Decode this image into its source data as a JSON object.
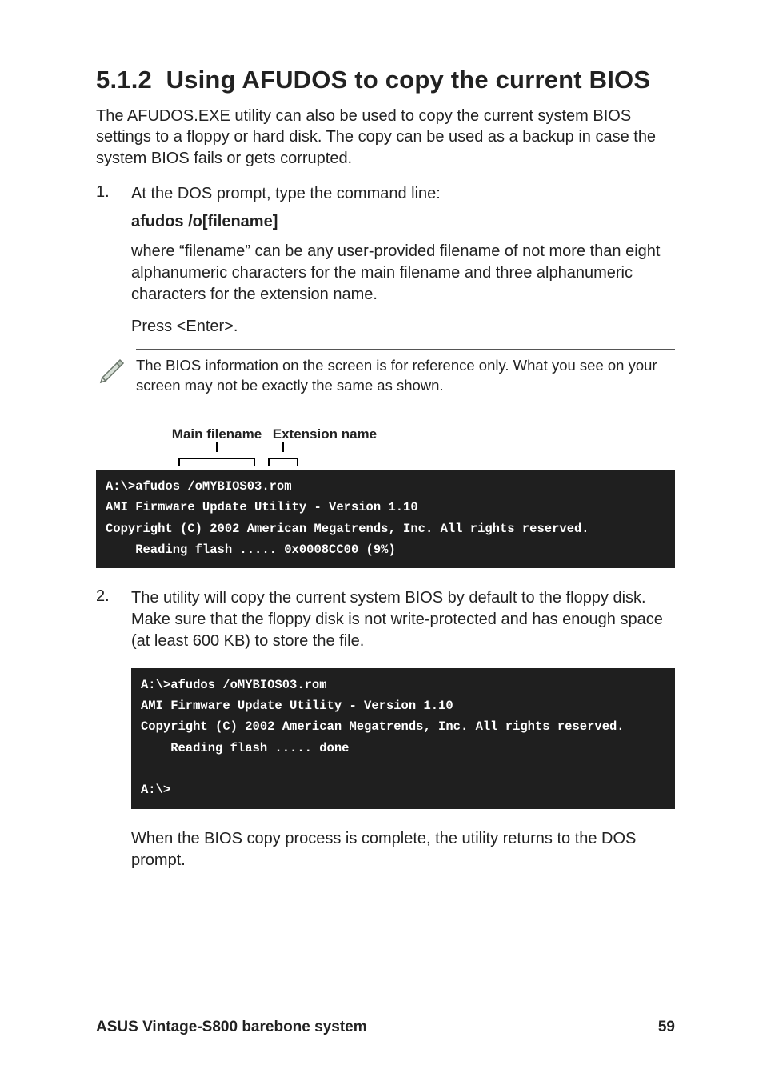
{
  "section": {
    "number": "5.1.2",
    "title": "Using AFUDOS to copy the current BIOS"
  },
  "intro": "The AFUDOS.EXE utility can also be used to copy the current system BIOS settings to a floppy or hard disk. The copy can be used as a backup in case the system BIOS fails or gets corrupted.",
  "step1": {
    "num": "1.",
    "text": "At the DOS prompt, type the command line:",
    "command": "afudos /o[filename]",
    "where": "where “filename” can be any user-provided filename of not more than eight alphanumeric characters for the main filename and three alphanumeric characters for the extension name.",
    "press": "Press  <Enter>."
  },
  "note": "The BIOS information on the screen is for reference only. What you see on your screen may not be exactly the same as shown.",
  "diagram": {
    "main_label": "Main filename",
    "ext_label": "Extension name"
  },
  "terminal1": {
    "line1": "A:\\>afudos /oMYBIOS03.rom",
    "line2": "AMI Firmware Update Utility - Version 1.10",
    "line3": "Copyright (C) 2002 American Megatrends, Inc. All rights reserved.",
    "line4": "    Reading flash ..... 0x0008CC00 (9%)"
  },
  "step2": {
    "num": "2.",
    "text": "The utility will copy the current system BIOS by default to the floppy disk. Make sure that the floppy disk is not write-protected and has enough space (at least 600 KB) to store the file."
  },
  "terminal2": {
    "line1": "A:\\>afudos /oMYBIOS03.rom",
    "line2": "AMI Firmware Update Utility - Version 1.10",
    "line3": "Copyright (C) 2002 American Megatrends, Inc. All rights reserved.",
    "line4": "    Reading flash ..... done",
    "blank": "",
    "line5": "A:\\>"
  },
  "closing": "When the BIOS copy process is complete, the utility returns to the DOS prompt.",
  "footer": {
    "left": "ASUS Vintage-S800 barebone system",
    "right": "59"
  }
}
